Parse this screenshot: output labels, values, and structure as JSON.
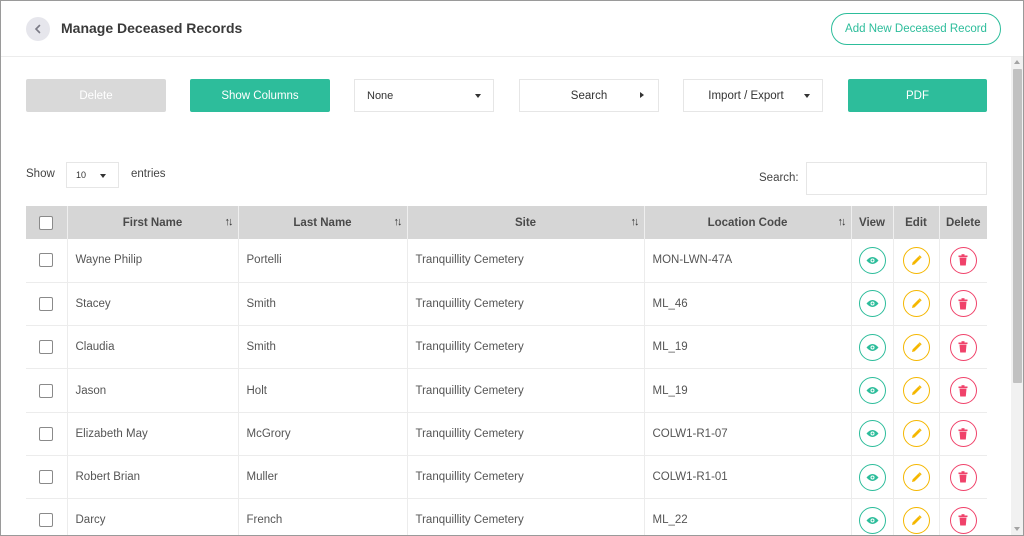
{
  "header": {
    "title": "Manage Deceased Records",
    "add_button_label": "Add New Deceased Record"
  },
  "toolbar": {
    "delete_label": "Delete",
    "show_columns_label": "Show Columns",
    "filter_selected": "None",
    "search_label": "Search",
    "import_export_label": "Import / Export",
    "pdf_label": "PDF"
  },
  "length_control": {
    "show_label": "Show",
    "value": "10",
    "entries_label": "entries"
  },
  "search": {
    "label": "Search:",
    "value": ""
  },
  "table": {
    "headers": [
      "First Name",
      "Last Name",
      "Site",
      "Location Code",
      "View",
      "Edit",
      "Delete"
    ],
    "rows": [
      {
        "first_name": "Wayne Philip",
        "last_name": "Portelli",
        "site": "Tranquillity Cemetery",
        "location_code": "MON-LWN-47A"
      },
      {
        "first_name": "Stacey",
        "last_name": "Smith",
        "site": "Tranquillity Cemetery",
        "location_code": "ML_46"
      },
      {
        "first_name": "Claudia",
        "last_name": "Smith",
        "site": "Tranquillity Cemetery",
        "location_code": "ML_19"
      },
      {
        "first_name": "Jason",
        "last_name": "Holt",
        "site": "Tranquillity Cemetery",
        "location_code": "ML_19"
      },
      {
        "first_name": "Elizabeth May",
        "last_name": "McGrory",
        "site": "Tranquillity Cemetery",
        "location_code": "COLW1-R1-07"
      },
      {
        "first_name": "Robert Brian",
        "last_name": "Muller",
        "site": "Tranquillity Cemetery",
        "location_code": "COLW1-R1-01"
      },
      {
        "first_name": "Darcy",
        "last_name": "French",
        "site": "Tranquillity Cemetery",
        "location_code": "ML_22"
      }
    ]
  },
  "icons": {
    "back": "chevron-left-icon",
    "view": "eye-icon",
    "edit": "pencil-icon",
    "delete": "trash-icon",
    "sort": "sort-arrows-icon"
  },
  "colors": {
    "accent": "#2dbd9b",
    "edit": "#f5b700",
    "danger": "#f0426a",
    "disabled": "#d9d9d9",
    "table_header": "#d6d6d6"
  }
}
